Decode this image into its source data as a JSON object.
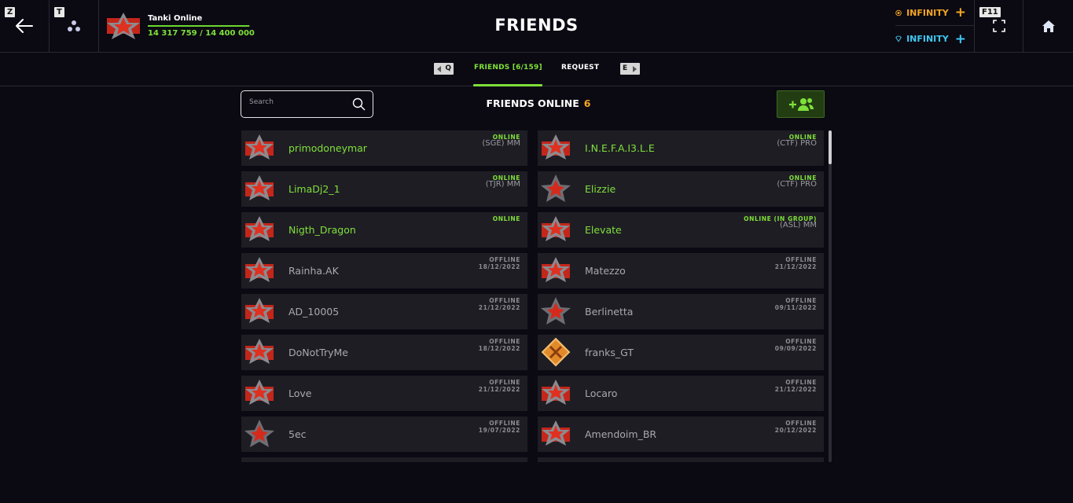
{
  "header": {
    "title": "FRIENDS",
    "back_key": "Z",
    "squad_key": "T",
    "fullscreen_key": "F11",
    "player": {
      "name": "Tanki Online",
      "xp": "14 317 759 / 14 400 000",
      "xp_progress": 0.994
    },
    "crystals": {
      "value": "INFINITY",
      "color": "#f5a623"
    },
    "premium": {
      "value": "INFINITY",
      "color": "#3fc7f0"
    }
  },
  "tabs": {
    "prev_key": "Q",
    "next_key": "E",
    "items": [
      {
        "label": "FRIENDS [6/159]",
        "active": true
      },
      {
        "label": "REQUEST",
        "active": false
      }
    ]
  },
  "controls": {
    "search_placeholder": "Search",
    "online_label": "FRIENDS ONLINE",
    "online_count": "6"
  },
  "friends": [
    {
      "name": "primodoneymar",
      "status": "ONLINE",
      "detail": "(SGE) MM",
      "online": true,
      "rank": "red"
    },
    {
      "name": "I.N.E.F.A.I3.L.E",
      "status": "ONLINE",
      "detail": "(CTF) PRO",
      "online": true,
      "rank": "red"
    },
    {
      "name": "LimaDj2_1",
      "status": "ONLINE",
      "detail": "(TJR) MM",
      "online": true,
      "rank": "red"
    },
    {
      "name": "Elizzie",
      "status": "ONLINE",
      "detail": "(CTF) PRO",
      "online": true,
      "rank": "silver"
    },
    {
      "name": "Nigth_Dragon",
      "status": "ONLINE",
      "detail": "",
      "online": true,
      "rank": "red"
    },
    {
      "name": "Elevate",
      "status": "ONLINE (IN GROUP)",
      "detail": "(ASL) MM",
      "online": true,
      "rank": "red"
    },
    {
      "name": "Rainha.AK",
      "status": "OFFLINE",
      "detail": "18/12/2022",
      "online": false,
      "rank": "red"
    },
    {
      "name": "Matezzo",
      "status": "OFFLINE",
      "detail": "21/12/2022",
      "online": false,
      "rank": "red"
    },
    {
      "name": "AD_10005",
      "status": "OFFLINE",
      "detail": "21/12/2022",
      "online": false,
      "rank": "red"
    },
    {
      "name": "Berlinetta",
      "status": "OFFLINE",
      "detail": "09/11/2022",
      "online": false,
      "rank": "silver"
    },
    {
      "name": "DoNotTryMe",
      "status": "OFFLINE",
      "detail": "18/12/2022",
      "online": false,
      "rank": "red"
    },
    {
      "name": "franks_GT",
      "status": "OFFLINE",
      "detail": "09/09/2022",
      "online": false,
      "rank": "orange"
    },
    {
      "name": "Love",
      "status": "OFFLINE",
      "detail": "21/12/2022",
      "online": false,
      "rank": "red"
    },
    {
      "name": "Locaro",
      "status": "OFFLINE",
      "detail": "21/12/2022",
      "online": false,
      "rank": "red"
    },
    {
      "name": "5ec",
      "status": "OFFLINE",
      "detail": "19/07/2022",
      "online": false,
      "rank": "silver"
    },
    {
      "name": "Amendoim_BR",
      "status": "OFFLINE",
      "detail": "20/12/2022",
      "online": false,
      "rank": "red"
    }
  ]
}
